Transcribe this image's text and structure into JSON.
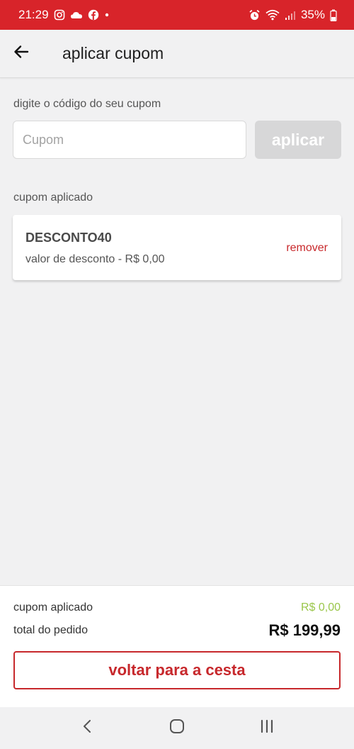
{
  "status_bar": {
    "time": "21:29",
    "battery": "35%",
    "left_icons": [
      "instagram-icon",
      "cloud-icon",
      "facebook-icon",
      "notification-dot-icon"
    ],
    "right_icons": [
      "alarm-icon",
      "wifi-icon",
      "signal-icon",
      "battery-icon"
    ]
  },
  "app_bar": {
    "title": "aplicar cupom",
    "back_icon": "arrow-left-icon"
  },
  "coupon_entry": {
    "label": "digite o código do seu cupom",
    "placeholder": "Cupom",
    "value": "",
    "apply_label": "aplicar"
  },
  "applied_section": {
    "label": "cupom aplicado",
    "coupon_code": "DESCONTO40",
    "coupon_description": "valor de desconto - R$ 0,00",
    "remove_label": "remover"
  },
  "footer": {
    "discount_label": "cupom aplicado",
    "discount_value": "R$ 0,00",
    "total_label": "total do pedido",
    "total_value": "R$ 199,99",
    "back_button_label": "voltar para a cesta"
  },
  "nav_bar": {
    "icons": [
      "back-nav-icon",
      "home-nav-icon",
      "recents-nav-icon"
    ]
  },
  "colors": {
    "brand_red": "#d8242a",
    "accent_red": "#c7282c",
    "discount_green": "#9ac64a",
    "disabled_button": "#d7d7d8"
  }
}
